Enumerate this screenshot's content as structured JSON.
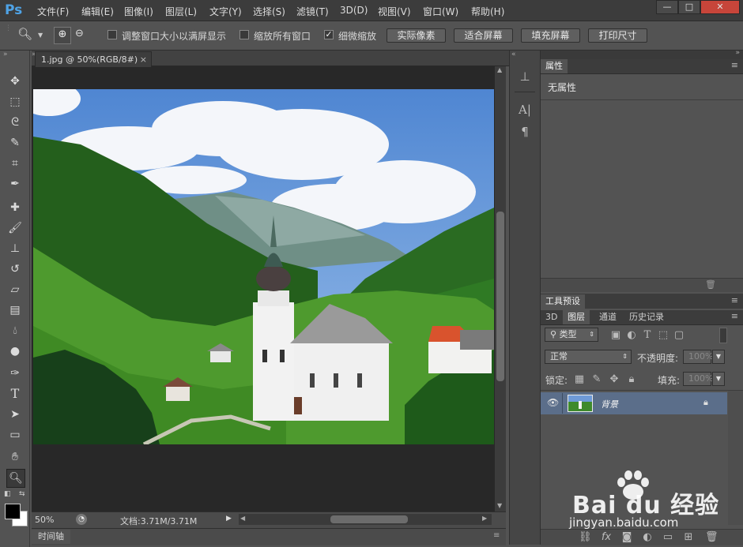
{
  "app": {
    "logo": "Ps"
  },
  "menu": [
    "文件(F)",
    "编辑(E)",
    "图像(I)",
    "图层(L)",
    "文字(Y)",
    "选择(S)",
    "滤镜(T)",
    "3D(D)",
    "视图(V)",
    "窗口(W)",
    "帮助(H)"
  ],
  "window_controls": {
    "minimize": "—",
    "maximize": "□",
    "close": "✕"
  },
  "options": {
    "resize_windows_label": "调整窗口大小以满屏显示",
    "resize_windows_checked": false,
    "zoom_all_label": "缩放所有窗口",
    "zoom_all_checked": false,
    "scrubby_zoom_label": "细微缩放",
    "scrubby_zoom_checked": true,
    "buttons": [
      "实际像素",
      "适合屏幕",
      "填充屏幕",
      "打印尺寸"
    ]
  },
  "document": {
    "tab_title": "1.jpg @ 50%(RGB/8#)",
    "tab_close": "×",
    "zoom": "50%",
    "doc_size": "文档:3.71M/3.71M"
  },
  "timeline": {
    "label": "时间轴"
  },
  "properties_panel": {
    "tab": "属性",
    "content": "无属性"
  },
  "tool_presets_panel": {
    "tab": "工具预设"
  },
  "layers_panel": {
    "tabs": [
      "3D",
      "图层",
      "通道",
      "历史记录"
    ],
    "active_tab": "图层",
    "filter_kind": "类型",
    "blend_mode": "正常",
    "opacity_label": "不透明度:",
    "opacity_value": "100%",
    "lock_label": "锁定:",
    "fill_label": "填充:",
    "fill_value": "100%",
    "layers": [
      {
        "name": "背景",
        "visible": true,
        "locked": true
      }
    ]
  },
  "watermark": {
    "brand": "Bai du 经验",
    "url": "jingyan.baidu.com"
  },
  "colors": {
    "accent": "#4fa3e6",
    "selected_layer": "#5b6e8a",
    "sky": "#5d8fd6",
    "grass": "#4e9a2e"
  }
}
